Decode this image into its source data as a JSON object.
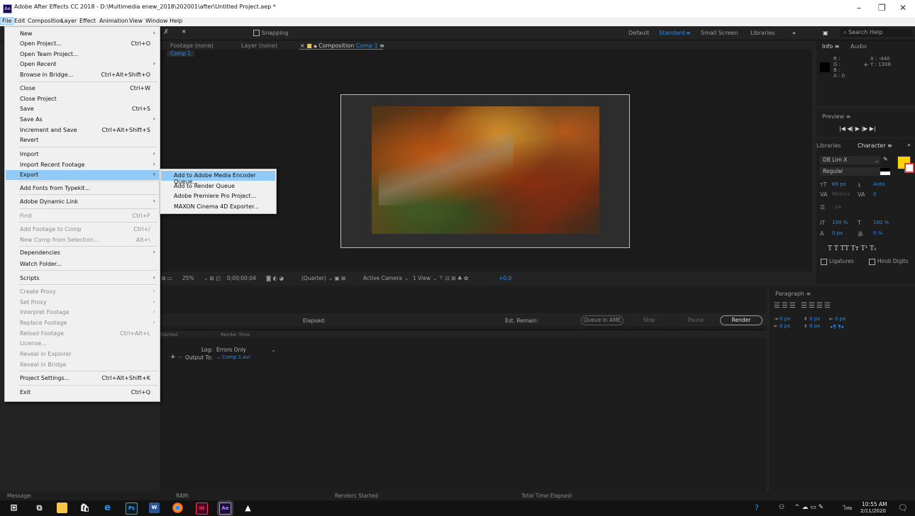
{
  "window": {
    "title": "Adobe After Effects CC 2018 - D:\\Multimedia enew_2018\\202001\\after\\Untitled Project.aep *",
    "app_icon": "Ae",
    "minimize_glyph": "–",
    "maximize_glyph": "❐",
    "close_glyph": "✕"
  },
  "menubar": [
    "File",
    "Edit",
    "Composition",
    "Layer",
    "Effect",
    "Animation",
    "View",
    "Window",
    "Help"
  ],
  "toolbar": {
    "snapping": "Snapping",
    "workspaces": [
      "Default",
      "Standard",
      "Small Screen",
      "Libraries"
    ],
    "active_workspace": "Standard",
    "search_placeholder": "Search Help"
  },
  "panels": {
    "footage_tab": "Footage (none)",
    "layer_tab": "Layer (none)",
    "composition_tab": "Composition",
    "composition_name": "Comp 1",
    "comp_crumb": "Comp 1"
  },
  "viewer_toolbar": {
    "zoom": "25%",
    "timecode": "0;00;00;04",
    "resolution": "(Quarter)",
    "camera": "Active Camera",
    "view": "1 View",
    "exposure": "+0.0"
  },
  "render_queue": {
    "elapsed_label": "Elapsed:",
    "est_remain_label": "Est. Remain:",
    "queue_in_ame": "Queue in AME",
    "stop": "Stop",
    "pause": "Pause",
    "render": "Render",
    "col_started": "Started",
    "col_render_time": "Render Time",
    "log_label": "Log:",
    "log_value": "Errors Only",
    "output_to_label": "Output To:",
    "output_to_value": "Comp 1.avi"
  },
  "info_panel": {
    "tab_info": "Info",
    "tab_audio": "Audio",
    "r": "R :",
    "g": "G :",
    "b": "B :",
    "a": "A :  0",
    "x": "X : -440",
    "y": "Y : 1308"
  },
  "preview_panel": {
    "title": "Preview",
    "controls": "|◀  ◀|  ▶  |▶  ▶|"
  },
  "character_panel": {
    "tab_libraries": "Libraries",
    "tab_character": "Character",
    "font": "DB Lim X",
    "style": "Regular",
    "size": "69 px",
    "leading": "Auto",
    "kerning": "Metrics",
    "tracking": "0",
    "stroke": "- px",
    "vscale": "100 %",
    "hscale": "100 %",
    "baseline": "0 px",
    "tsume": "0 %",
    "styles": "T  T  TT  Tт  T¹  T₁",
    "ligatures": "Ligatures",
    "hindi_digits": "Hindi Digits",
    "fill_color": "#ffd200"
  },
  "paragraph_panel": {
    "title": "Paragraph",
    "indent_left": "0 px",
    "indent_right": "0 px",
    "indent_first": "0 px",
    "space_before": "0 px",
    "space_after": "0 px"
  },
  "statusbar": {
    "message": "Message:",
    "ram": "RAM:",
    "renders_started": "Renders Started:",
    "total_time_elapsed": "Total Time Elapsed:"
  },
  "taskbar": {
    "time": "10:55 AM",
    "date": "2/11/2020",
    "language": "ไทย",
    "apps": [
      "start",
      "task-view",
      "file-explorer",
      "store",
      "edge",
      "photoshop",
      "word",
      "chrome",
      "indesign",
      "after-effects",
      "photos"
    ]
  },
  "file_menu": [
    {
      "label": "New",
      "shortcut": "",
      "arrow": true,
      "disabled": false
    },
    {
      "label": "Open Project...",
      "shortcut": "Ctrl+O",
      "arrow": false,
      "disabled": false
    },
    {
      "label": "Open Team Project...",
      "shortcut": "",
      "arrow": false,
      "disabled": false
    },
    {
      "label": "Open Recent",
      "shortcut": "",
      "arrow": true,
      "disabled": false
    },
    {
      "label": "Browse in Bridge...",
      "shortcut": "Ctrl+Alt+Shift+O",
      "arrow": false,
      "disabled": false
    },
    {
      "label": "Close",
      "shortcut": "Ctrl+W",
      "arrow": false,
      "disabled": false
    },
    {
      "label": "Close Project",
      "shortcut": "",
      "arrow": false,
      "disabled": false
    },
    {
      "label": "Save",
      "shortcut": "Ctrl+S",
      "arrow": false,
      "disabled": false
    },
    {
      "label": "Save As",
      "shortcut": "",
      "arrow": true,
      "disabled": false
    },
    {
      "label": "Increment and Save",
      "shortcut": "Ctrl+Alt+Shift+S",
      "arrow": false,
      "disabled": false
    },
    {
      "label": "Revert",
      "shortcut": "",
      "arrow": false,
      "disabled": false
    },
    {
      "label": "Import",
      "shortcut": "",
      "arrow": true,
      "disabled": false
    },
    {
      "label": "Import Recent Footage",
      "shortcut": "",
      "arrow": true,
      "disabled": false
    },
    {
      "label": "Export",
      "shortcut": "",
      "arrow": true,
      "disabled": false,
      "highlighted": true
    },
    {
      "label": "Add Fonts from Typekit...",
      "shortcut": "",
      "arrow": false,
      "disabled": false
    },
    {
      "label": "Adobe Dynamic Link",
      "shortcut": "",
      "arrow": true,
      "disabled": false
    },
    {
      "label": "Find",
      "shortcut": "Ctrl+F",
      "arrow": false,
      "disabled": true
    },
    {
      "label": "Add Footage to Comp",
      "shortcut": "Ctrl+/",
      "arrow": false,
      "disabled": true
    },
    {
      "label": "New Comp from Selection...",
      "shortcut": "Alt+\\",
      "arrow": false,
      "disabled": true
    },
    {
      "label": "Dependencies",
      "shortcut": "",
      "arrow": true,
      "disabled": false
    },
    {
      "label": "Watch Folder...",
      "shortcut": "",
      "arrow": false,
      "disabled": false
    },
    {
      "label": "Scripts",
      "shortcut": "",
      "arrow": true,
      "disabled": false
    },
    {
      "label": "Create Proxy",
      "shortcut": "",
      "arrow": true,
      "disabled": true
    },
    {
      "label": "Set Proxy",
      "shortcut": "",
      "arrow": true,
      "disabled": true
    },
    {
      "label": "Interpret Footage",
      "shortcut": "",
      "arrow": true,
      "disabled": true
    },
    {
      "label": "Replace Footage",
      "shortcut": "",
      "arrow": true,
      "disabled": true
    },
    {
      "label": "Reload Footage",
      "shortcut": "Ctrl+Alt+L",
      "arrow": false,
      "disabled": true
    },
    {
      "label": "License...",
      "shortcut": "",
      "arrow": false,
      "disabled": true
    },
    {
      "label": "Reveal in Explorer",
      "shortcut": "",
      "arrow": false,
      "disabled": true
    },
    {
      "label": "Reveal in Bridge",
      "shortcut": "",
      "arrow": false,
      "disabled": true
    },
    {
      "label": "Project Settings...",
      "shortcut": "Ctrl+Alt+Shift+K",
      "arrow": false,
      "disabled": false
    },
    {
      "label": "Exit",
      "shortcut": "Ctrl+Q",
      "arrow": false,
      "disabled": false
    }
  ],
  "export_submenu": [
    {
      "label": "Add to Adobe Media Encoder Queue...",
      "highlighted": true
    },
    {
      "label": "Add to Render Queue",
      "highlighted": false
    },
    {
      "label": "Adobe Premiere Pro Project...",
      "highlighted": false
    },
    {
      "label": "MAXON Cinema 4D Exporter...",
      "highlighted": false
    }
  ]
}
